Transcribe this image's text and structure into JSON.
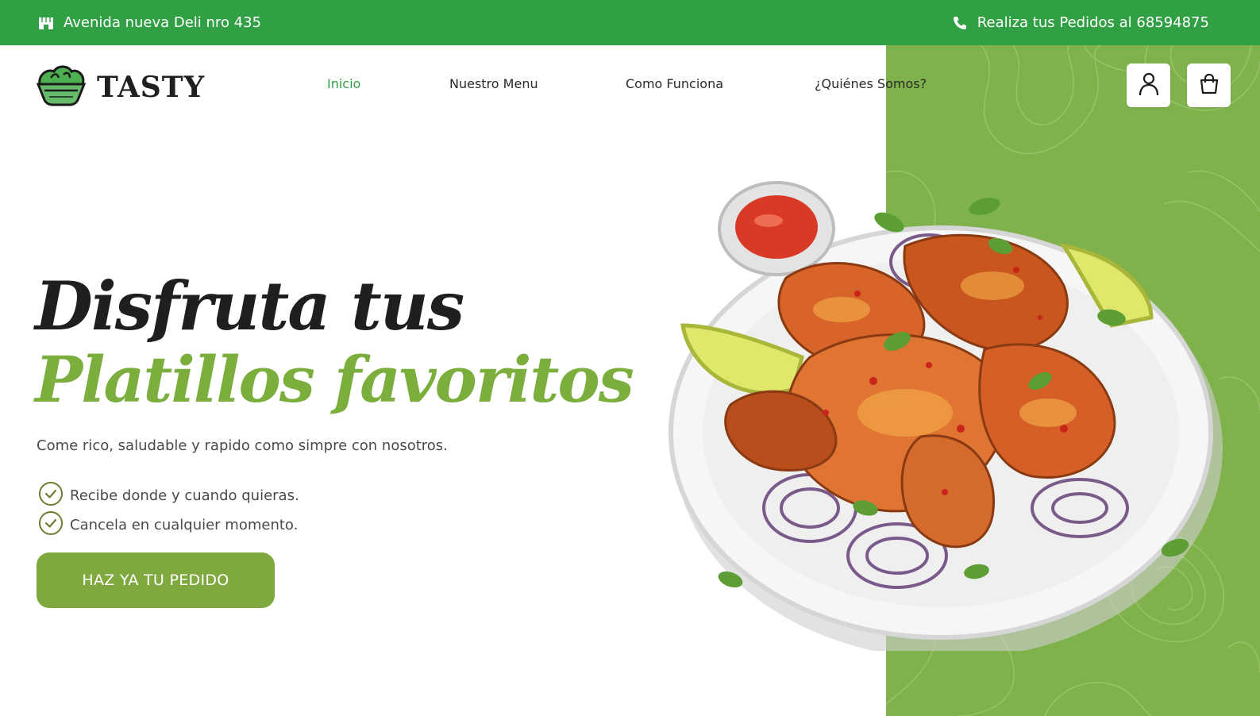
{
  "topbar": {
    "address": "Avenida nueva Deli nro 435",
    "address_icon": "store-icon",
    "phone_text": "Realiza tus Pedidos al 68594875",
    "phone_icon": "phone-icon",
    "bg_color": "#319f44"
  },
  "header": {
    "brand": "TASTY",
    "logo_icon": "salad-bowl-icon",
    "nav": [
      {
        "label": "Inicio",
        "active": true
      },
      {
        "label": "Nuestro Menu",
        "active": false
      },
      {
        "label": "Como Funciona",
        "active": false
      },
      {
        "label": "¿Quiénes Somos?",
        "active": false
      }
    ],
    "user_icon": "user-icon",
    "cart_icon": "shopping-bag-icon"
  },
  "hero": {
    "title_line1": "Disfruta tus",
    "title_line2": "Platillos favoritos",
    "subtitle": "Come rico, saludable y rapido como simpre con nosotros.",
    "benefits": [
      "Recibe donde y cuando quieras.",
      "Cancela en cualquier momento."
    ],
    "check_icon": "check-circle-icon",
    "cta_label": "HAZ YA TU PEDIDO",
    "image": "chicken-wings-plate-illustration"
  },
  "colors": {
    "primary_green": "#319f44",
    "accent_green": "#7cae3d",
    "panel_green": "#7fb24b",
    "cta_green": "#7fa93f",
    "text_dark": "#1f1f1f"
  }
}
